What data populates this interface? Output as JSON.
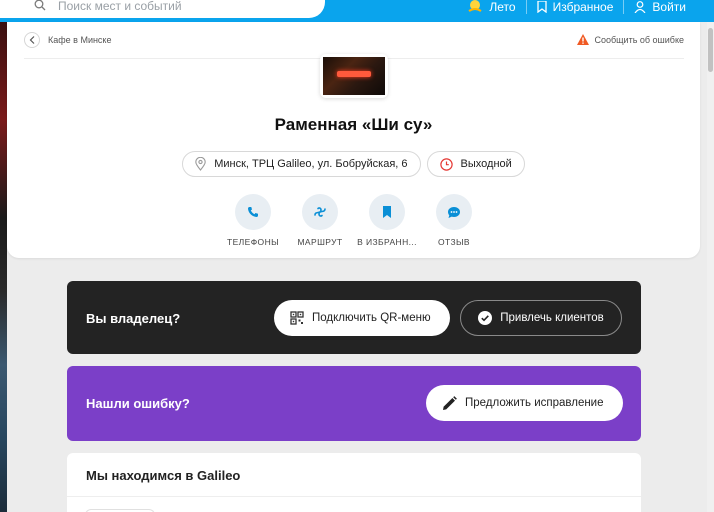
{
  "header": {
    "search_placeholder": "Поиск мест и событий",
    "nav": [
      {
        "label": "Лето",
        "icon": "sun-icon"
      },
      {
        "label": "Избранное",
        "icon": "bookmark-icon"
      },
      {
        "label": "Войти",
        "icon": "user-icon"
      }
    ]
  },
  "place": {
    "breadcrumb": "Кафе в Минске",
    "report_error": "Сообщить об ошибке",
    "logo_alt": "Ши су",
    "title": "Раменная «Ши су»",
    "address": "Минск, ТРЦ Galileo, ул. Бобруйская, 6",
    "status": "Выходной",
    "actions": [
      {
        "label": "ТЕЛЕФОНЫ",
        "icon": "phone-icon"
      },
      {
        "label": "МАРШРУТ",
        "icon": "route-icon"
      },
      {
        "label": "В ИЗБРАНН...",
        "icon": "bookmark-icon"
      },
      {
        "label": "ОТЗЫВ",
        "icon": "comment-icon"
      }
    ]
  },
  "owner": {
    "question": "Вы владелец?",
    "qr_button": "Подключить QR-меню",
    "clients_button": "Привлечь клиентов"
  },
  "error_block": {
    "question": "Нашли ошибку?",
    "fix_button": "Предложить исправление"
  },
  "location": {
    "heading": "Мы находимся в Galileo"
  },
  "colors": {
    "brand_blue": "#0aa4ed",
    "owner_bg": "#232323",
    "error_bg": "#7b3fc8",
    "status_red": "#e53935"
  }
}
